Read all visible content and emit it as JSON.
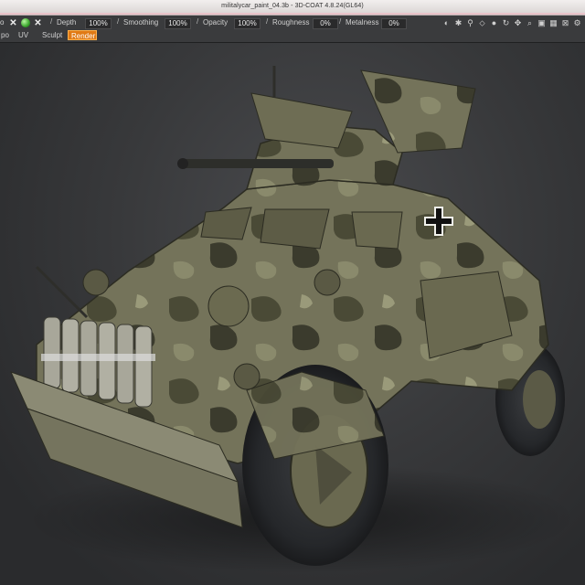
{
  "window": {
    "title": "militalycar_paint_04.3b - 3D-COAT 4.8.24(GL64)"
  },
  "toolbar": {
    "left_stub": "o",
    "sliders": [
      {
        "label": "Depth",
        "value": "100%"
      },
      {
        "label": "Smoothing",
        "value": "100%"
      },
      {
        "label": "Opacity",
        "value": "100%"
      },
      {
        "label": "Roughness",
        "value": "0%"
      },
      {
        "label": "Metalness",
        "value": "0%"
      }
    ]
  },
  "rooms": [
    {
      "label": "po",
      "active": false
    },
    {
      "label": "UV",
      "active": false
    },
    {
      "label": "Sculpt",
      "active": false
    },
    {
      "label": "Render",
      "active": true
    }
  ],
  "right_icons": [
    "navigation-icon",
    "light-icon",
    "pin-icon",
    "fill-icon",
    "drop-icon",
    "rotate-icon",
    "move-icon",
    "zoom-icon",
    "frame-icon",
    "grid-icon",
    "snap-icon",
    "settings-icon"
  ],
  "colors": {
    "accent": "#e07a15",
    "vehicle_base": "#6b6a4e",
    "camo_dark": "#3a3a2c"
  },
  "viewport": {
    "content": "armored car model"
  }
}
